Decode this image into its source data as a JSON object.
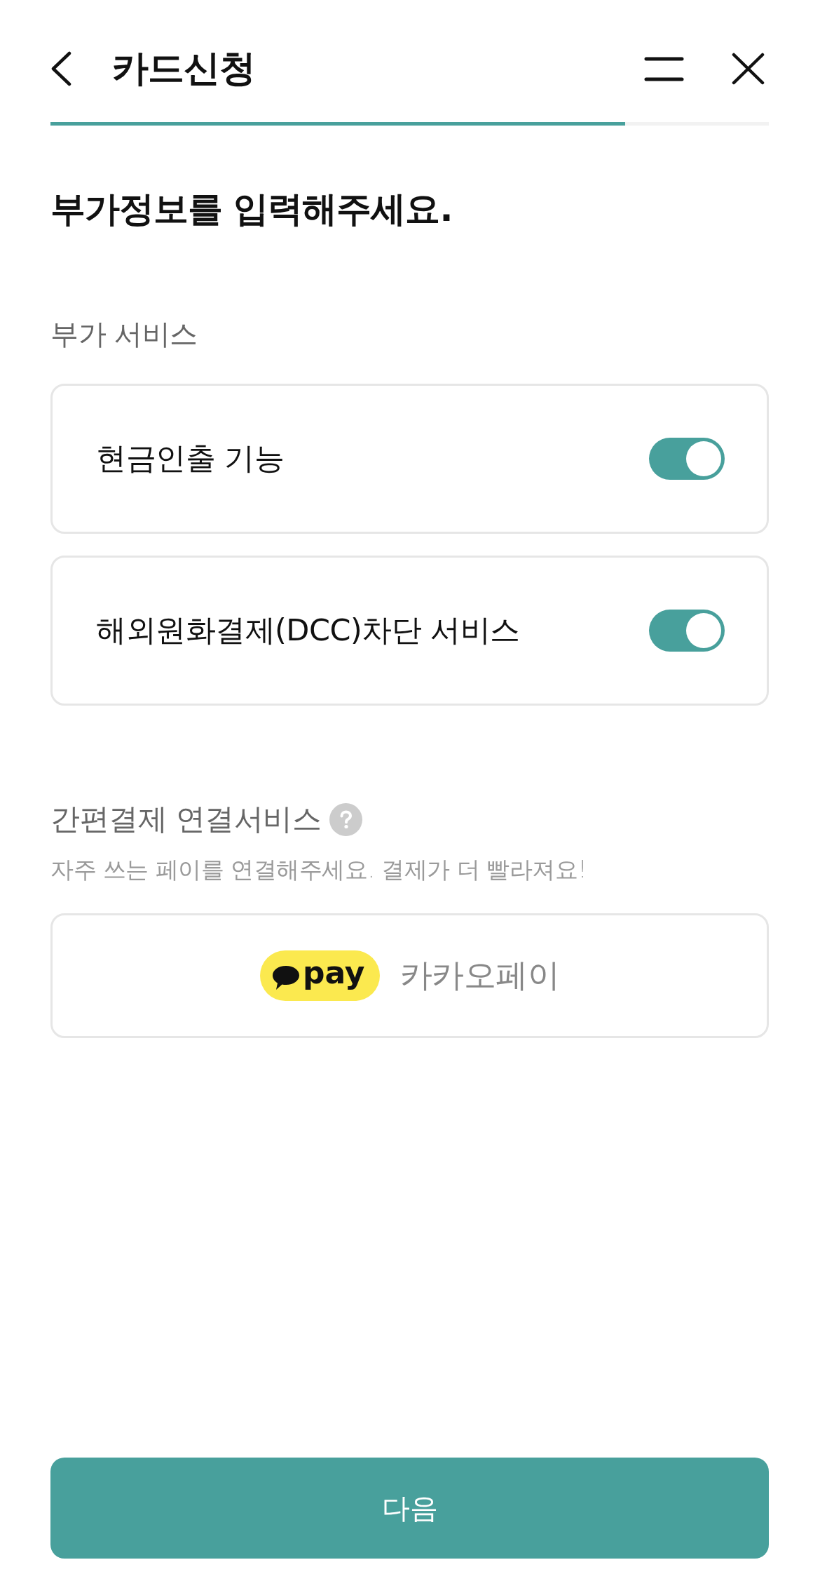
{
  "header": {
    "title": "카드신청",
    "progress": {
      "level": 0.8
    }
  },
  "heading": "부가정보를 입력해주세요.",
  "additional_services": {
    "title": "부가 서비스",
    "items": [
      {
        "label": "현금인출 기능",
        "on": true
      },
      {
        "label": "해외원화결제(DCC)차단 서비스",
        "on": true
      }
    ]
  },
  "easy_payment": {
    "title": "간편결제 연결서비스",
    "description": "자주 쓰는 페이를 연결해주세요. 결제가 더 빨라져요!",
    "options": [
      {
        "logo_text": "pay",
        "label": "카카오페이"
      }
    ]
  },
  "next_button": "다음"
}
